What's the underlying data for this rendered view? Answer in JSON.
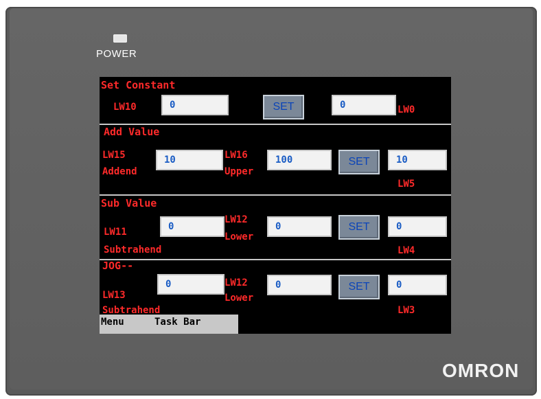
{
  "device": {
    "power_label": "POWER",
    "brand": "OMRON"
  },
  "screen": {
    "section1": {
      "title": "Set Constant",
      "left_label": "LW10",
      "left_value": "0",
      "set_label": "SET",
      "right_value": "0",
      "right_label": "LW0"
    },
    "section2": {
      "title": "Add Value",
      "addend_label_1": "LW15",
      "addend_label_2": "Addend",
      "addend_value": "10",
      "upper_label_1": "LW16",
      "upper_label_2": "Upper",
      "upper_value": "100",
      "set_label": "SET",
      "result_value": "10",
      "result_label": "LW5"
    },
    "section3": {
      "title": "Sub Value",
      "sub_label_1": "LW11",
      "sub_label_2": "Subtrahend",
      "sub_value": "0",
      "lower_label_1": "LW12",
      "lower_label_2": "Lower",
      "lower_value": "0",
      "set_label": "SET",
      "result_value": "0",
      "result_label": "LW4"
    },
    "section4": {
      "title": "JOG--",
      "sub_label_1": "LW13",
      "sub_label_2": "Subtrahend",
      "sub_value": "0",
      "lower_label_1": "LW12",
      "lower_label_2": "Lower",
      "lower_value": "0",
      "set_label": "SET",
      "result_value": "0",
      "result_label": "LW3"
    },
    "taskbar": {
      "menu": "Menu",
      "task_bar": "Task Bar"
    }
  }
}
